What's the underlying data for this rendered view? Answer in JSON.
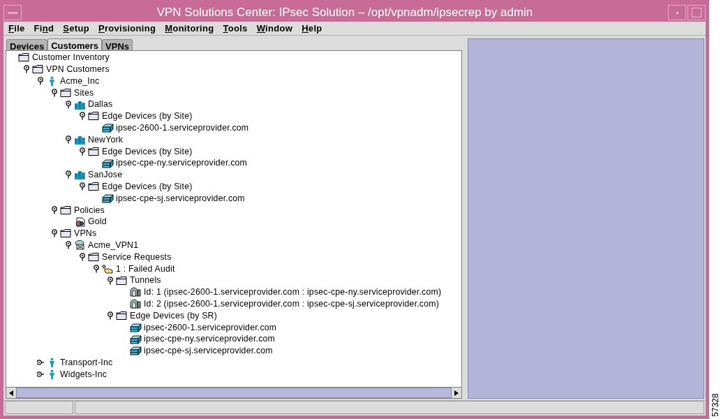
{
  "window": {
    "title": "VPN Solutions Center: IPsec Solution – /opt/vpnadm/ipsecrep by admin"
  },
  "menu": [
    {
      "mnemonic": "F",
      "rest": "ile"
    },
    {
      "before": "Fi",
      "mnemonic": "n",
      "rest": "d"
    },
    {
      "mnemonic": "S",
      "rest": "etup"
    },
    {
      "mnemonic": "P",
      "rest": "rovisioning"
    },
    {
      "mnemonic": "M",
      "rest": "onitoring"
    },
    {
      "mnemonic": "T",
      "rest": "ools"
    },
    {
      "mnemonic": "W",
      "rest": "indow"
    },
    {
      "mnemonic": "H",
      "rest": "elp"
    }
  ],
  "tabs": [
    {
      "label": "Devices",
      "selected": false
    },
    {
      "label": "Customers",
      "selected": true
    },
    {
      "label": "VPNs",
      "selected": false
    }
  ],
  "tree": [
    {
      "label": "Customer Inventory",
      "kind": "folder",
      "children": [
        {
          "label": "VPN Customers",
          "kind": "folder",
          "expanded": true,
          "children": [
            {
              "label": "Acme_Inc",
              "kind": "customer",
              "expanded": true,
              "children": [
                {
                  "label": "Sites",
                  "kind": "folder",
                  "expanded": true,
                  "children": [
                    {
                      "label": "Dallas",
                      "kind": "site",
                      "expanded": true,
                      "children": [
                        {
                          "label": "Edge Devices (by Site)",
                          "kind": "folder",
                          "expanded": true,
                          "children": [
                            {
                              "label": "ipsec-2600-1.serviceprovider.com",
                              "kind": "device"
                            }
                          ]
                        }
                      ]
                    },
                    {
                      "label": "NewYork",
                      "kind": "site",
                      "expanded": true,
                      "children": [
                        {
                          "label": "Edge Devices (by Site)",
                          "kind": "folder",
                          "expanded": true,
                          "children": [
                            {
                              "label": "ipsec-cpe-ny.serviceprovider.com",
                              "kind": "device"
                            }
                          ]
                        }
                      ]
                    },
                    {
                      "label": "SanJose",
                      "kind": "site",
                      "expanded": true,
                      "children": [
                        {
                          "label": "Edge Devices (by Site)",
                          "kind": "folder",
                          "expanded": true,
                          "children": [
                            {
                              "label": "ipsec-cpe-sj.serviceprovider.com",
                              "kind": "device"
                            }
                          ]
                        }
                      ]
                    }
                  ]
                },
                {
                  "label": "Policies",
                  "kind": "folder",
                  "expanded": true,
                  "children": [
                    {
                      "label": "Gold",
                      "kind": "policy"
                    }
                  ]
                },
                {
                  "label": "VPNs",
                  "kind": "folder",
                  "expanded": true,
                  "children": [
                    {
                      "label": "Acme_VPN1",
                      "kind": "vpn",
                      "expanded": true,
                      "children": [
                        {
                          "label": "Service Requests",
                          "kind": "folder",
                          "expanded": true,
                          "children": [
                            {
                              "label": "1 : Failed Audit",
                              "kind": "request",
                              "expanded": true,
                              "children": [
                                {
                                  "label": "Tunnels",
                                  "kind": "folder",
                                  "expanded": true,
                                  "children": [
                                    {
                                      "label": "Id: 1 (ipsec-2600-1.serviceprovider.com : ipsec-cpe-ny.serviceprovider.com)",
                                      "kind": "tunnel"
                                    },
                                    {
                                      "label": "Id: 2 (ipsec-2600-1.serviceprovider.com : ipsec-cpe-sj.serviceprovider.com)",
                                      "kind": "tunnel"
                                    }
                                  ]
                                },
                                {
                                  "label": "Edge Devices (by SR)",
                                  "kind": "folder",
                                  "expanded": true,
                                  "children": [
                                    {
                                      "label": "ipsec-2600-1.serviceprovider.com",
                                      "kind": "device"
                                    },
                                    {
                                      "label": "ipsec-cpe-ny.serviceprovider.com",
                                      "kind": "device"
                                    },
                                    {
                                      "label": "ipsec-cpe-sj.serviceprovider.com",
                                      "kind": "device"
                                    }
                                  ]
                                }
                              ]
                            }
                          ]
                        }
                      ]
                    }
                  ]
                }
              ]
            },
            {
              "label": "Transport-Inc",
              "kind": "customer",
              "expanded": false
            },
            {
              "label": "Widgets-Inc",
              "kind": "customer",
              "expanded": false
            }
          ]
        }
      ]
    }
  ],
  "figure_id": "57328"
}
